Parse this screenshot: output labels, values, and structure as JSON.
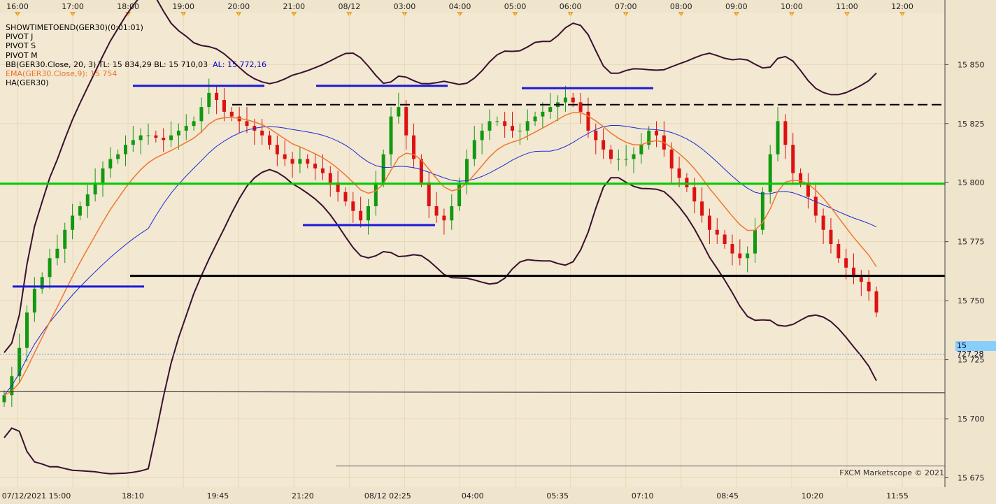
{
  "chart_data": {
    "type": "candlestick",
    "symbol": "GER30",
    "legend": [
      {
        "text": "SHOWTIMETOEND(GER30)(0:01:01)",
        "color": "#000000"
      },
      {
        "text": "PIVOT J",
        "color": "#000000"
      },
      {
        "text": "PIVOT S",
        "color": "#000000"
      },
      {
        "text": "PIVOT M",
        "color": "#000000"
      },
      {
        "text": "BB(GER30.Close, 20, 3)  TL: 15 834,29  BL: 15 710,03",
        "color": "#000000",
        "extra": "AL: 15 772,16",
        "extra_color": "#0000cc"
      },
      {
        "text": "EMA(GER30.Close,9): 15 754",
        "color": "#e8732a"
      },
      {
        "text": "HA(GER30)",
        "color": "#000000"
      }
    ],
    "top_time_labels": [
      "16:00",
      "17:00",
      "18:00",
      "19:00",
      "20:00",
      "21:00",
      "08/12",
      "03:00",
      "04:00",
      "05:00",
      "06:00",
      "07:00",
      "08:00",
      "09:00",
      "10:00",
      "11:00",
      "12:00"
    ],
    "bottom_time_labels": [
      "07/12/2021 15:00",
      "18:10",
      "19:45",
      "21:20",
      "08/12 02:25",
      "04:00",
      "05:35",
      "07:10",
      "08:45",
      "10:20",
      "11:55"
    ],
    "y_ticks": [
      "15 850",
      "15 825",
      "15 800",
      "15 775",
      "15 750",
      "15 725",
      "15 700",
      "15 675"
    ],
    "y_tick_values": [
      15850,
      15825,
      15800,
      15775,
      15750,
      15725,
      15700,
      15675
    ],
    "ylim": [
      15671,
      15872
    ],
    "last_price_label": "15 727,28",
    "last_price": 15727.28,
    "pivot_levels": [
      {
        "name": "green",
        "value": 15799.5,
        "color": "#00cc00"
      },
      {
        "name": "black",
        "value": 15760.5,
        "color": "#000000"
      },
      {
        "name": "dashed",
        "value": 15833,
        "color": "#000000"
      }
    ],
    "close_series": [
      15710,
      15718,
      15730,
      15745,
      15755,
      15760,
      15768,
      15772,
      15780,
      15786,
      15790,
      15795,
      15800,
      15806,
      15810,
      15812,
      15816,
      15818,
      15820,
      15820,
      15819,
      15818,
      15820,
      15822,
      15824,
      15826,
      15832,
      15838,
      15835,
      15830,
      15828,
      15826,
      15824,
      15822,
      15820,
      15816,
      15812,
      15810,
      15808,
      15810,
      15808,
      15806,
      15804,
      15800,
      15796,
      15792,
      15788,
      15784,
      15790,
      15800,
      15812,
      15828,
      15832,
      15820,
      15810,
      15800,
      15790,
      15786,
      15784,
      15790,
      15800,
      15810,
      15818,
      15822,
      15826,
      15826,
      15824,
      15822,
      15822,
      15826,
      15828,
      15830,
      15832,
      15834,
      15836,
      15834,
      15830,
      15822,
      15818,
      15814,
      15810,
      15810,
      15810,
      15812,
      15816,
      15822,
      15820,
      15814,
      15806,
      15802,
      15798,
      15792,
      15786,
      15780,
      15778,
      15774,
      15770,
      15768,
      15770,
      15780,
      15796,
      15812,
      15826,
      15816,
      15804,
      15800,
      15794,
      15786,
      15780,
      15774,
      15768,
      15764,
      15760,
      15758,
      15754,
      15745
    ],
    "ema_label": "EMA 9",
    "sma_label": "BB middle",
    "watermark": "FXCM Marketscope © 2021"
  }
}
